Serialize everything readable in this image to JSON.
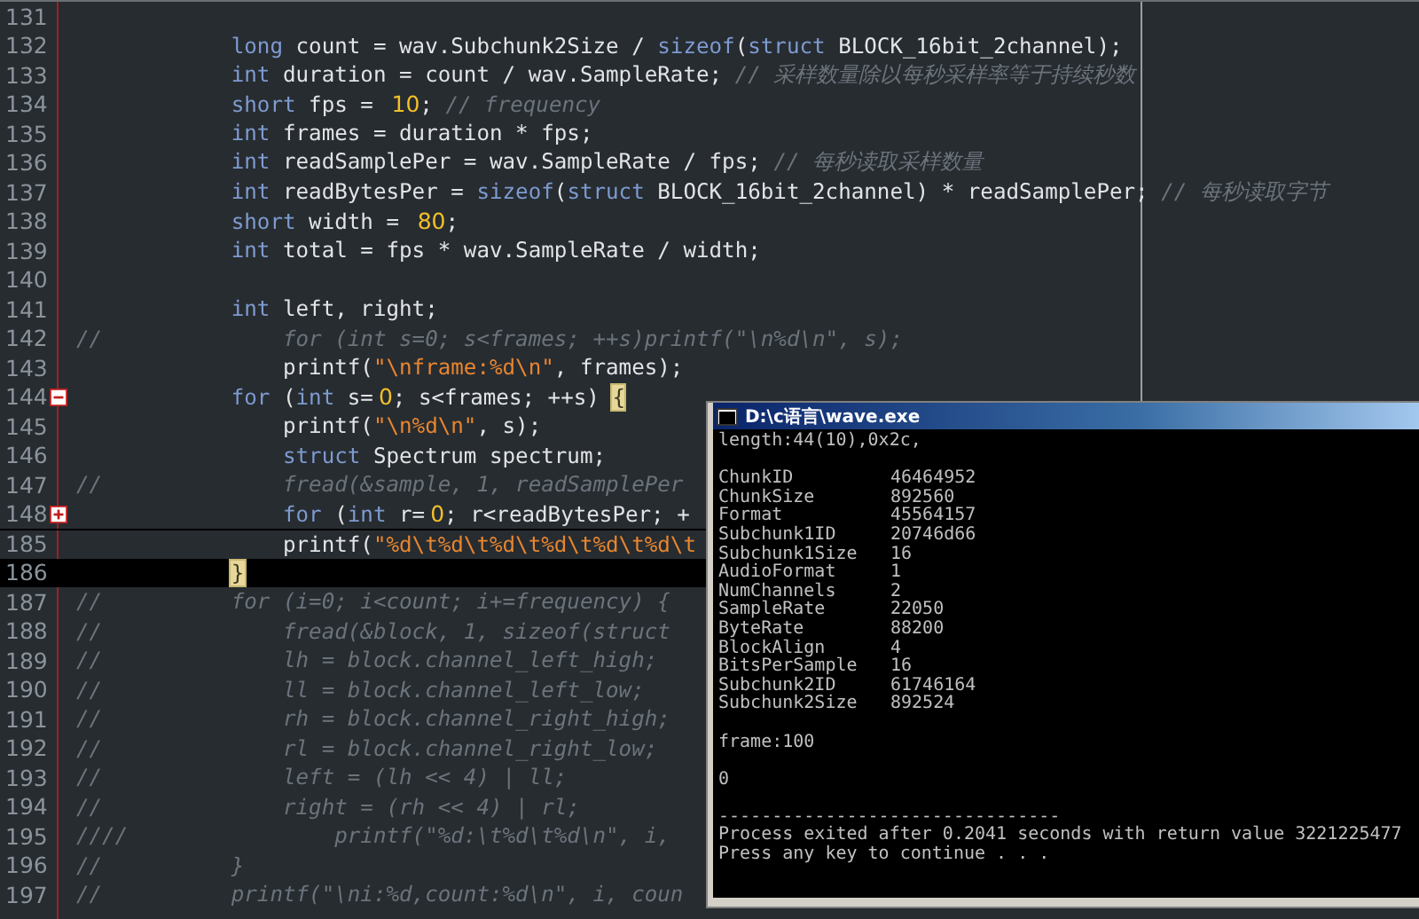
{
  "editor": {
    "lines": [
      {
        "number": "131",
        "current": false
      },
      {
        "number": "132",
        "current": false,
        "tokens": [
          {
            "kind": "kw",
            "text": "            long"
          },
          {
            "kind": "id",
            "text": " count = wav.Subchunk2Size / "
          },
          {
            "kind": "kw",
            "text": "sizeof"
          },
          {
            "kind": "id",
            "text": "("
          },
          {
            "kind": "kw",
            "text": "struct"
          },
          {
            "kind": "id",
            "text": " BLOCK_16bit_2channel);"
          }
        ]
      },
      {
        "number": "133",
        "current": false,
        "tokens": [
          {
            "kind": "kw",
            "text": "            int"
          },
          {
            "kind": "id",
            "text": " duration = count / wav.SampleRate; "
          },
          {
            "kind": "cmt",
            "text": "// 采样数量除以每秒采样率等于持续秒数"
          }
        ]
      },
      {
        "number": "134",
        "current": false,
        "tokens": [
          {
            "kind": "kw",
            "text": "            short"
          },
          {
            "kind": "id",
            "text": " fps = "
          },
          {
            "kind": "num",
            "text": "10"
          },
          {
            "kind": "id",
            "text": "; "
          },
          {
            "kind": "cmt",
            "text": "// frequency"
          }
        ]
      },
      {
        "number": "135",
        "current": false,
        "tokens": [
          {
            "kind": "kw",
            "text": "            int"
          },
          {
            "kind": "id",
            "text": " frames = duration * fps;"
          }
        ]
      },
      {
        "number": "136",
        "current": false,
        "tokens": [
          {
            "kind": "kw",
            "text": "            int"
          },
          {
            "kind": "id",
            "text": " readSamplePer = wav.SampleRate / fps; "
          },
          {
            "kind": "cmt",
            "text": "// 每秒读取采样数量"
          }
        ]
      },
      {
        "number": "137",
        "current": false,
        "tokens": [
          {
            "kind": "kw",
            "text": "            int"
          },
          {
            "kind": "id",
            "text": " readBytesPer = "
          },
          {
            "kind": "kw",
            "text": "sizeof"
          },
          {
            "kind": "id",
            "text": "("
          },
          {
            "kind": "kw",
            "text": "struct"
          },
          {
            "kind": "id",
            "text": " BLOCK_16bit_2channel) * readSamplePer; "
          },
          {
            "kind": "cmt",
            "text": "// 每秒读取字节"
          }
        ]
      },
      {
        "number": "138",
        "current": false,
        "tokens": [
          {
            "kind": "kw",
            "text": "            short"
          },
          {
            "kind": "id",
            "text": " width = "
          },
          {
            "kind": "num",
            "text": "80"
          },
          {
            "kind": "id",
            "text": ";"
          }
        ]
      },
      {
        "number": "139",
        "current": false,
        "tokens": [
          {
            "kind": "kw",
            "text": "            int"
          },
          {
            "kind": "id",
            "text": " total = fps * wav.SampleRate / width;"
          }
        ]
      },
      {
        "number": "140",
        "current": false
      },
      {
        "number": "141",
        "current": false,
        "tokens": [
          {
            "kind": "kw",
            "text": "            int"
          },
          {
            "kind": "id",
            "text": " left, right;"
          }
        ]
      },
      {
        "number": "142",
        "current": false,
        "tokens": [
          {
            "kind": "cmt",
            "text": "//              for (int s=0; s<frames; ++s)printf(\"\\n%d\\n\", s);"
          }
        ]
      },
      {
        "number": "143",
        "current": false,
        "tokens": [
          {
            "kind": "id",
            "text": "                printf("
          },
          {
            "kind": "str",
            "text": "\"\\nframe:%d\\n\""
          },
          {
            "kind": "id",
            "text": ", frames);"
          }
        ]
      },
      {
        "number": "144",
        "current": false,
        "expanded": true,
        "tokens": [
          {
            "kind": "kw",
            "text": "            for"
          },
          {
            "kind": "id",
            "text": " ("
          },
          {
            "kind": "kw",
            "text": "int"
          },
          {
            "kind": "id",
            "text": " s="
          },
          {
            "kind": "num",
            "text": "0"
          },
          {
            "kind": "id",
            "text": "; s<frames; ++s) "
          },
          {
            "kind": "match",
            "text": "{"
          }
        ]
      },
      {
        "number": "145",
        "current": false,
        "tokens": [
          {
            "kind": "id",
            "text": "                printf("
          },
          {
            "kind": "str",
            "text": "\"\\n%d\\n\""
          },
          {
            "kind": "id",
            "text": ", s);"
          }
        ]
      },
      {
        "number": "146",
        "current": false,
        "tokens": [
          {
            "kind": "kw",
            "text": "                struct"
          },
          {
            "kind": "id",
            "text": " Spectrum spectrum;"
          }
        ]
      },
      {
        "number": "147",
        "current": false,
        "tokens": [
          {
            "kind": "cmt",
            "text": "//              fread(&sample, 1, readSamplePer"
          }
        ]
      },
      {
        "number": "148",
        "current": false,
        "expanded": false,
        "tokens": [
          {
            "kind": "kw",
            "text": "                for"
          },
          {
            "kind": "id",
            "text": " ("
          },
          {
            "kind": "kw",
            "text": "int"
          },
          {
            "kind": "id",
            "text": " r="
          },
          {
            "kind": "num",
            "text": "0"
          },
          {
            "kind": "id",
            "text": "; r<readBytesPer; +"
          }
        ]
      },
      {
        "number": "185",
        "current": false,
        "tokens": [
          {
            "kind": "id",
            "text": "                printf("
          },
          {
            "kind": "str",
            "text": "\"%d\\t%d\\t%d\\t%d\\t%d\\t%d\\t"
          }
        ]
      },
      {
        "number": "186",
        "current": true,
        "tokens": [
          {
            "kind": "match",
            "text": "            }"
          }
        ]
      },
      {
        "number": "187",
        "current": false,
        "tokens": [
          {
            "kind": "cmt",
            "text": "//          for (i=0; i<count; i+=frequency) {"
          }
        ]
      },
      {
        "number": "188",
        "current": false,
        "tokens": [
          {
            "kind": "cmt",
            "text": "//              fread(&block, 1, sizeof(struct"
          }
        ]
      },
      {
        "number": "189",
        "current": false,
        "tokens": [
          {
            "kind": "cmt",
            "text": "//              lh = block.channel_left_high;"
          }
        ]
      },
      {
        "number": "190",
        "current": false,
        "tokens": [
          {
            "kind": "cmt",
            "text": "//              ll = block.channel_left_low;"
          }
        ]
      },
      {
        "number": "191",
        "current": false,
        "tokens": [
          {
            "kind": "cmt",
            "text": "//              rh = block.channel_right_high;"
          }
        ]
      },
      {
        "number": "192",
        "current": false,
        "tokens": [
          {
            "kind": "cmt",
            "text": "//              rl = block.channel_right_low;"
          }
        ]
      },
      {
        "number": "193",
        "current": false,
        "tokens": [
          {
            "kind": "cmt",
            "text": "//              left = (lh << 4) | ll;"
          }
        ]
      },
      {
        "number": "194",
        "current": false,
        "tokens": [
          {
            "kind": "cmt",
            "text": "//              right = (rh << 4) | rl;"
          }
        ]
      },
      {
        "number": "195",
        "current": false,
        "tokens": [
          {
            "kind": "cmt",
            "text": "////                printf(\"%d:\\t%d\\t%d\\n\", i,"
          }
        ]
      },
      {
        "number": "196",
        "current": false,
        "tokens": [
          {
            "kind": "cmt",
            "text": "//          }"
          }
        ]
      },
      {
        "number": "197",
        "current": false,
        "tokens": [
          {
            "kind": "cmt",
            "text": "//          printf(\"\\ni:%d,count:%d\\n\", i, coun"
          }
        ]
      }
    ]
  },
  "console": {
    "title": "D:\\c语言\\wave.exe",
    "output": [
      {
        "kind": "text",
        "text": "length:44(10),0x2c,"
      },
      {
        "kind": "blank"
      },
      {
        "kind": "field",
        "name": "ChunkID",
        "value": "46464952"
      },
      {
        "kind": "field",
        "name": "ChunkSize",
        "value": "892560"
      },
      {
        "kind": "field",
        "name": "Format",
        "value": "45564157"
      },
      {
        "kind": "field",
        "name": "Subchunk1ID",
        "value": "20746d66"
      },
      {
        "kind": "field",
        "name": "Subchunk1Size",
        "value": "16"
      },
      {
        "kind": "field",
        "name": "AudioFormat",
        "value": "1"
      },
      {
        "kind": "field",
        "name": "NumChannels",
        "value": "2"
      },
      {
        "kind": "field",
        "name": "SampleRate",
        "value": "22050"
      },
      {
        "kind": "field",
        "name": "ByteRate",
        "value": "88200"
      },
      {
        "kind": "field",
        "name": "BlockAlign",
        "value": "4"
      },
      {
        "kind": "field",
        "name": "BitsPerSample",
        "value": "16"
      },
      {
        "kind": "field",
        "name": "Subchunk2ID",
        "value": "61746164"
      },
      {
        "kind": "field",
        "name": "Subchunk2Size",
        "value": "892524"
      },
      {
        "kind": "blank"
      },
      {
        "kind": "text",
        "text": "frame:100"
      },
      {
        "kind": "blank"
      },
      {
        "kind": "text",
        "text": "0"
      },
      {
        "kind": "blank"
      },
      {
        "kind": "text",
        "text": "--------------------------------"
      },
      {
        "kind": "text",
        "text": "Process exited after 0.2041 seconds with return value 3221225477"
      },
      {
        "kind": "text",
        "text": "Press any key to continue . . ."
      }
    ]
  }
}
